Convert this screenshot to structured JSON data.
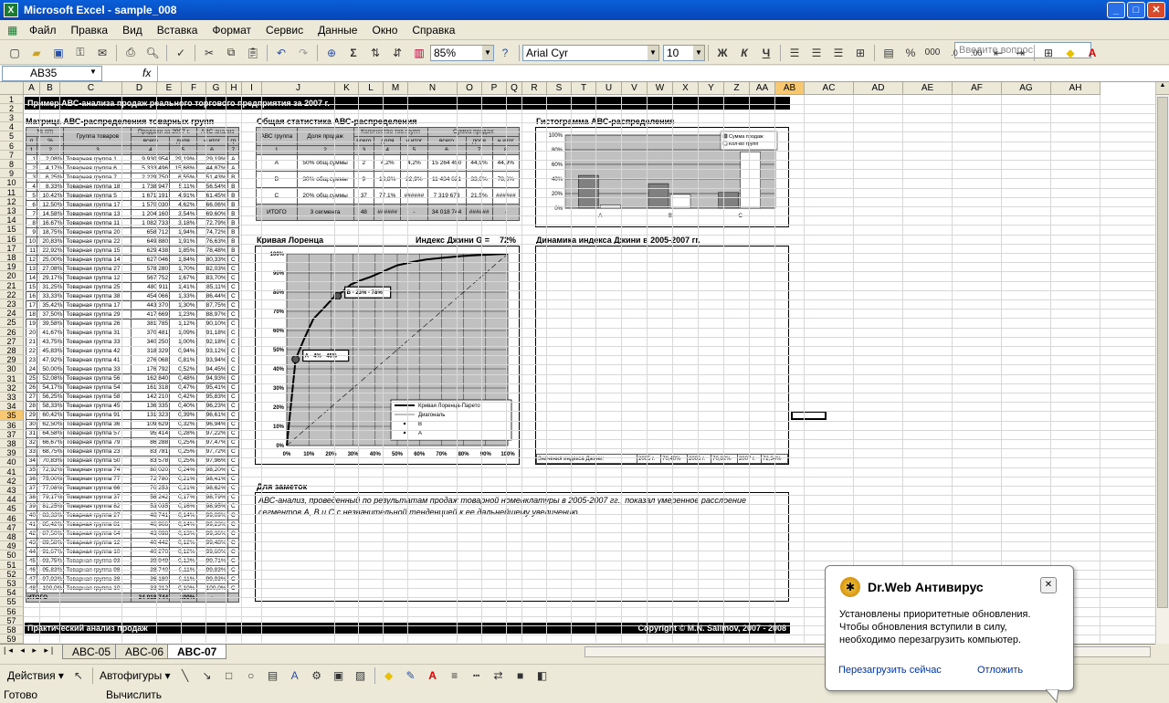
{
  "window": {
    "title": "Microsoft Excel - sample_008"
  },
  "menu": {
    "items": [
      "Файл",
      "Правка",
      "Вид",
      "Вставка",
      "Формат",
      "Сервис",
      "Данные",
      "Окно",
      "Справка"
    ],
    "help_placeholder": "Введите вопрос"
  },
  "toolbar": {
    "zoom": "85%",
    "font": "Arial Cyr",
    "size": "10",
    "bold": "Ж",
    "italic": "К",
    "underline": "Ч",
    "percent": "%",
    "thousands": "000"
  },
  "formula": {
    "cell_ref": "AB35",
    "fx": "fx"
  },
  "columns": [
    "A",
    "B",
    "C",
    "D",
    "E",
    "F",
    "G",
    "H",
    "I",
    "J",
    "K",
    "L",
    "M",
    "N",
    "O",
    "P",
    "Q",
    "R",
    "S",
    "T",
    "U",
    "V",
    "W",
    "X",
    "Y",
    "Z",
    "AA",
    "AB",
    "AC",
    "AD",
    "AE",
    "AF",
    "AG",
    "AH"
  ],
  "rows": [
    "1",
    "2",
    "3",
    "4",
    "5",
    "6",
    "7",
    "8",
    "9",
    "10",
    "11",
    "12",
    "13",
    "14",
    "15",
    "16",
    "17",
    "18",
    "19",
    "20",
    "21",
    "22",
    "23",
    "24",
    "25",
    "26",
    "27",
    "28",
    "29",
    "30",
    "31",
    "32",
    "33",
    "34",
    "35",
    "36",
    "37",
    "38",
    "39",
    "40",
    "41",
    "42",
    "43",
    "44",
    "45",
    "46",
    "47",
    "48",
    "49",
    "50",
    "51",
    "52",
    "53",
    "54",
    "55",
    "56",
    "57",
    "58",
    "59"
  ],
  "sheet": {
    "title": "Пример АВС-анализа продаж реального торгового предприятия за 2007 г.",
    "matrix_title": "Матрица АВС-распределения товарных групп",
    "stats_title": "Общая статистика АВС-распределения",
    "histo_title": "Гистограмма АВС-распределения",
    "lorenz_title": "Кривая Лоренца",
    "gini_label": "Индекс Джини G =",
    "gini_value": "72%",
    "dynamics_title": "Динамика индекса Джини в 2005-2007 гг.",
    "notes_title": "Для заметок",
    "notes_text_1": "АВС-анализ, проведенный по результатам продаж товарной номенклатуры в 2005-2007 гг., показал умеренное расслоение",
    "notes_text_2": "сегментов А, В и С с незначительной тенденцией к ее дальнейшему увеличению.",
    "footer_left": "Практический анализ продаж",
    "footer_right": "Copyright © M.N. Salimov, 2007 - 2008",
    "dyn_row": [
      "Значения индекса Джини:",
      "2005 г.",
      "70,40%",
      "2006 г.",
      "70,82%",
      "2007 г.",
      "72,34%"
    ]
  },
  "matrix": {
    "headers": [
      "№ п/п",
      "Группа товаров",
      "Продажи за 2007 г.",
      "АВС-анализ"
    ],
    "sub": [
      "п",
      "%",
      "",
      "всего",
      "доля",
      "н.итог",
      "гр"
    ],
    "nums": [
      "1",
      "2",
      "3",
      "4",
      "5",
      "6",
      "7"
    ],
    "rows": [
      [
        "1",
        "2,08%",
        "Товарная группа 1",
        "9 930 954",
        "29,19%",
        "29,19%",
        "A"
      ],
      [
        "2",
        "4,17%",
        "Товарная группа 6",
        "5 333 496",
        "15,68%",
        "44,87%",
        "A"
      ],
      [
        "3",
        "6,25%",
        "Товарная группа 7",
        "2 229 750",
        "6,55%",
        "51,43%",
        "B"
      ],
      [
        "4",
        "8,33%",
        "Товарная группа 18",
        "1 738 947",
        "5,11%",
        "56,54%",
        "B"
      ],
      [
        "5",
        "10,42%",
        "Товарная группа 5",
        "1 671 191",
        "4,91%",
        "61,45%",
        "B"
      ],
      [
        "6",
        "12,50%",
        "Товарная группа 17",
        "1 570 030",
        "4,62%",
        "66,06%",
        "B"
      ],
      [
        "7",
        "14,58%",
        "Товарная группа 13",
        "1 204 160",
        "3,54%",
        "69,60%",
        "B"
      ],
      [
        "8",
        "16,67%",
        "Товарная группа 11",
        "1 082 733",
        "3,18%",
        "72,79%",
        "B"
      ],
      [
        "9",
        "18,75%",
        "Товарная группа 20",
        "658 712",
        "1,94%",
        "74,72%",
        "B"
      ],
      [
        "10",
        "20,83%",
        "Товарная группа 22",
        "649 880",
        "1,91%",
        "76,63%",
        "B"
      ],
      [
        "11",
        "22,92%",
        "Товарная группа 15",
        "629 438",
        "1,85%",
        "78,48%",
        "B"
      ],
      [
        "12",
        "25,00%",
        "Товарная группа 14",
        "627 046",
        "1,84%",
        "80,33%",
        "C"
      ],
      [
        "13",
        "27,08%",
        "Товарная группа 27",
        "578 280",
        "1,70%",
        "82,03%",
        "C"
      ],
      [
        "14",
        "29,17%",
        "Товарная группа 12",
        "567 752",
        "1,67%",
        "83,70%",
        "C"
      ],
      [
        "15",
        "31,25%",
        "Товарная группа 25",
        "480 911",
        "1,41%",
        "85,11%",
        "C"
      ],
      [
        "16",
        "33,33%",
        "Товарная группа 38",
        "454 066",
        "1,33%",
        "86,44%",
        "C"
      ],
      [
        "17",
        "35,42%",
        "Товарная группа 17",
        "443 370",
        "1,30%",
        "87,75%",
        "C"
      ],
      [
        "18",
        "37,50%",
        "Товарная группа 29",
        "417 669",
        "1,23%",
        "88,97%",
        "C"
      ],
      [
        "19",
        "39,58%",
        "Товарная группа 26",
        "381 785",
        "1,12%",
        "90,10%",
        "C"
      ],
      [
        "20",
        "41,67%",
        "Товарная группа 31",
        "370 481",
        "1,09%",
        "91,18%",
        "C"
      ],
      [
        "21",
        "43,75%",
        "Товарная группа 33",
        "340 250",
        "1,00%",
        "92,18%",
        "C"
      ],
      [
        "22",
        "45,83%",
        "Товарная группа 42",
        "318 329",
        "0,94%",
        "93,12%",
        "C"
      ],
      [
        "23",
        "47,92%",
        "Товарная группа 41",
        "276 068",
        "0,81%",
        "93,94%",
        "C"
      ],
      [
        "24",
        "50,00%",
        "Товарная группа 33",
        "176 792",
        "0,52%",
        "94,45%",
        "C"
      ],
      [
        "25",
        "52,08%",
        "Товарная группа 56",
        "162 840",
        "0,48%",
        "94,93%",
        "C"
      ],
      [
        "26",
        "54,17%",
        "Товарная группа 54",
        "161 318",
        "0,47%",
        "95,41%",
        "C"
      ],
      [
        "27",
        "56,25%",
        "Товарная группа 58",
        "142 210",
        "0,42%",
        "95,83%",
        "C"
      ],
      [
        "28",
        "58,33%",
        "Товарная группа 45",
        "136 335",
        "0,40%",
        "96,23%",
        "C"
      ],
      [
        "29",
        "60,42%",
        "Товарная группа 91",
        "131 323",
        "0,39%",
        "96,61%",
        "C"
      ],
      [
        "30",
        "62,50%",
        "Товарная группа 36",
        "109 629",
        "0,32%",
        "96,94%",
        "C"
      ],
      [
        "31",
        "64,58%",
        "Товарная группа 57",
        "95 414",
        "0,28%",
        "97,22%",
        "C"
      ],
      [
        "32",
        "66,67%",
        "Товарная группа 79",
        "86 288",
        "0,25%",
        "97,47%",
        "C"
      ],
      [
        "33",
        "68,75%",
        "Товарная группа 23",
        "83 781",
        "0,25%",
        "97,72%",
        "C"
      ],
      [
        "34",
        "70,83%",
        "Товарная группа 50",
        "83 578",
        "0,25%",
        "97,96%",
        "C"
      ],
      [
        "35",
        "72,92%",
        "Товарная группа 74",
        "80 020",
        "0,24%",
        "98,20%",
        "C"
      ],
      [
        "36",
        "75,00%",
        "Товарная группа 77",
        "72 780",
        "0,21%",
        "98,41%",
        "C"
      ],
      [
        "37",
        "77,08%",
        "Товарная группа 66",
        "70 253",
        "0,21%",
        "98,62%",
        "C"
      ],
      [
        "38",
        "79,17%",
        "Товарная группа 37",
        "58 242",
        "0,17%",
        "98,79%",
        "C"
      ],
      [
        "39",
        "81,25%",
        "Товарная группа 82",
        "53 035",
        "0,16%",
        "98,95%",
        "C"
      ],
      [
        "40",
        "83,33%",
        "Товарная группа 27",
        "48 741",
        "0,14%",
        "99,09%",
        "C"
      ],
      [
        "41",
        "85,42%",
        "Товарная группа 81",
        "46 966",
        "0,14%",
        "99,23%",
        "C"
      ],
      [
        "42",
        "87,50%",
        "Товарная группа 64",
        "43 098",
        "0,13%",
        "99,36%",
        "C"
      ],
      [
        "43",
        "89,58%",
        "Товарная группа 12",
        "40 442",
        "0,12%",
        "99,48%",
        "C"
      ],
      [
        "44",
        "91,67%",
        "Товарная группа 10",
        "40 270",
        "0,12%",
        "99,60%",
        "C"
      ],
      [
        "45",
        "93,75%",
        "Товарная группа 93",
        "39 949",
        "0,12%",
        "99,71%",
        "C"
      ],
      [
        "46",
        "95,83%",
        "Товарная группа 98",
        "38 740",
        "0,11%",
        "99,83%",
        "C"
      ],
      [
        "47",
        "97,92%",
        "Товарная группа 38",
        "36 180",
        "0,11%",
        "99,93%",
        "C"
      ],
      [
        "48",
        "100,0%",
        "Товарная группа 10",
        "33 212",
        "0,10%",
        "100,0%",
        "C"
      ]
    ],
    "total": [
      "ИТОГО",
      "",
      "",
      "34 018 744",
      "100%",
      "-",
      ""
    ]
  },
  "stats": {
    "headers": [
      "АВС группа",
      "Доля продаж",
      "Количество тов.групп",
      "Сумма продаж"
    ],
    "sub": [
      "всего",
      "доля",
      "н.итог",
      "всего",
      "доля",
      "н.итог"
    ],
    "nums": [
      "1",
      "2",
      "3",
      "4",
      "5",
      "6",
      "7",
      "8"
    ],
    "rows": [
      [
        "A",
        "50% общ.суммы",
        "2",
        "4,2%",
        "4,2%",
        "15 264 450",
        "44,9%",
        "44,9%"
      ],
      [
        "B",
        "30% общ.суммы",
        "9",
        "18,8%",
        "22,9%",
        "11 434 621",
        "33,6%",
        "78,6%"
      ],
      [
        "C",
        "20% общ.суммы",
        "37",
        "77,1%",
        "######",
        "7 319 673",
        "21,5%",
        "######"
      ],
      [
        "ИТОГО",
        "3 сегмента",
        "48",
        "######",
        "-",
        "34 018 744",
        "######",
        "-"
      ]
    ]
  },
  "chart_data": [
    {
      "type": "bar",
      "title": "Гистограмма АВС-распределения",
      "categories": [
        "A",
        "B",
        "C"
      ],
      "series": [
        {
          "name": "Сумма продаж",
          "values": [
            44.9,
            33.6,
            21.5
          ]
        },
        {
          "name": "Кол-во групп",
          "values": [
            4.2,
            18.8,
            77.1
          ]
        }
      ],
      "ylim": [
        0,
        100
      ],
      "yticks": [
        "0%",
        "20%",
        "40%",
        "60%",
        "80%",
        "100%"
      ],
      "legend": "top-right",
      "colors": [
        "#808080",
        "#ffffff"
      ]
    },
    {
      "type": "line",
      "title": "Кривая Лоренца",
      "x": [
        0,
        4,
        8,
        12,
        17,
        21,
        25,
        29,
        33,
        38,
        42,
        46,
        50,
        54,
        58,
        63,
        67,
        71,
        75,
        79,
        83,
        88,
        92,
        96,
        100
      ],
      "series": [
        {
          "name": "Кривая Лоренца-Парето",
          "values": [
            0,
            45,
            56,
            66,
            72,
            77,
            80,
            84,
            86,
            88,
            90,
            92,
            94,
            95,
            96,
            97,
            97.5,
            98,
            98.4,
            98.8,
            99.1,
            99.4,
            99.6,
            99.8,
            100
          ]
        },
        {
          "name": "Диагональ",
          "values": [
            0,
            4,
            8,
            12,
            17,
            21,
            25,
            29,
            33,
            38,
            42,
            46,
            50,
            54,
            58,
            63,
            67,
            71,
            75,
            79,
            83,
            88,
            92,
            96,
            100
          ]
        }
      ],
      "points": [
        {
          "name": "A",
          "label": "A - 4% - 45%",
          "x": 4,
          "y": 45
        },
        {
          "name": "B",
          "label": "B - 23% - 78%",
          "x": 23,
          "y": 78
        }
      ],
      "xticks": [
        "0%",
        "10%",
        "20%",
        "30%",
        "40%",
        "50%",
        "60%",
        "70%",
        "80%",
        "90%",
        "100%"
      ],
      "yticks": [
        "0%",
        "10%",
        "20%",
        "30%",
        "40%",
        "50%",
        "60%",
        "70%",
        "80%",
        "90%",
        "100%"
      ],
      "legend": "bottom-right"
    }
  ],
  "sheet_tabs": [
    "ABC-05",
    "ABC-06",
    "ABC-07"
  ],
  "draw": {
    "actions": "Действия",
    "autoshapes": "Автофигуры"
  },
  "status": {
    "left": "Готово",
    "mid": "Вычислить"
  },
  "notify": {
    "title": "Dr.Web Антивирус",
    "line1": "Установлены приоритетные обновления.",
    "line2": "Чтобы обновления вступили в силу,",
    "line3": "необходимо перезагрузить компьютер.",
    "restart": "Перезагрузить сейчас",
    "later": "Отложить",
    "close": "✕"
  }
}
